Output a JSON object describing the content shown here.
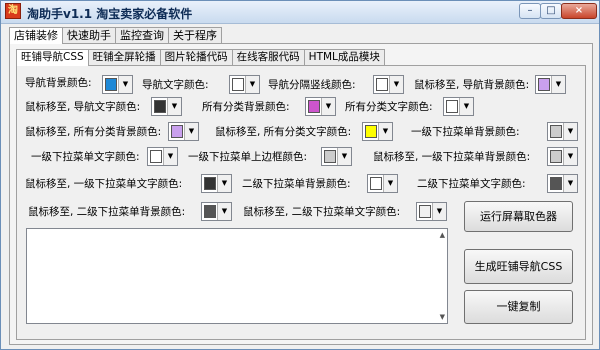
{
  "window": {
    "icon_text": "淘",
    "title": "淘助手v1.1 淘宝卖家必备软件",
    "buttons": {
      "minimize": "–",
      "maximize": "□",
      "close": "×"
    }
  },
  "main_tabs": [
    "店铺装修",
    "快速助手",
    "监控查询",
    "关于程序"
  ],
  "sub_tabs": [
    "旺铺导航CSS",
    "旺铺全屏轮播",
    "图片轮播代码",
    "在线客服代码",
    "HTML成品模块"
  ],
  "settings": [
    {
      "label": "导航背景颜色:",
      "color": "#1e88d6"
    },
    {
      "label": "导航文字颜色:",
      "color": "#ffffff"
    },
    {
      "label": "导航分隔竖线颜色:",
      "color": "#ffffff"
    },
    {
      "label": "鼠标移至, 导航背景颜色:",
      "color": "#c9a0ee"
    },
    {
      "label": "鼠标移至, 导航文字颜色:",
      "color": "#333333"
    },
    {
      "label": "所有分类背景颜色:",
      "color": "#cc55cc"
    },
    {
      "label": "所有分类文字颜色:",
      "color": "#ffffff"
    },
    {
      "label": "鼠标移至, 所有分类背景颜色:",
      "color": "#c9a0ee"
    },
    {
      "label": "鼠标移至, 所有分类文字颜色:",
      "color": "#ffff00"
    },
    {
      "label": "一级下拉菜单背景颜色:",
      "color": "#cccccc"
    },
    {
      "label": "一级下拉菜单文字颜色:",
      "color": "#ffffff"
    },
    {
      "label": "一级下拉菜单上边框颜色:",
      "color": "#cccccc"
    },
    {
      "label": "鼠标移至, 一级下拉菜单背景颜色:",
      "color": "#cccccc"
    },
    {
      "label": "鼠标移至, 一级下拉菜单文字颜色:",
      "color": "#333333"
    },
    {
      "label": "二级下拉菜单背景颜色:",
      "color": "#ffffff"
    },
    {
      "label": "二级下拉菜单文字颜色:",
      "color": "#555555"
    },
    {
      "label": "鼠标移至, 二级下拉菜单背景颜色:",
      "color": "#555555"
    },
    {
      "label": "鼠标移至, 二级下拉菜单文字颜色:",
      "color": "#f0f0f0"
    }
  ],
  "output_text": "",
  "buttons": {
    "color_picker": "运行屏幕取色器",
    "generate_css": "生成旺铺导航CSS",
    "copy_all": "一键复制"
  }
}
